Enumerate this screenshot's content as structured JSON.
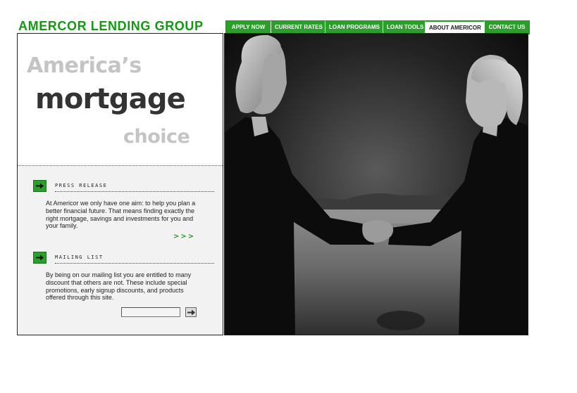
{
  "brand": {
    "name": "AMERCOR LENDING GROUP",
    "color": "#129a12"
  },
  "nav": {
    "items": [
      {
        "label": "APPLY NOW"
      },
      {
        "label": "CURRENT RATES"
      },
      {
        "label": "LOAN PROGRAMS"
      },
      {
        "label": "LOAN TOOLS"
      },
      {
        "label": "ABOUT AMERICOR",
        "active": true
      },
      {
        "label": "CONTACT US"
      }
    ],
    "accent": "#2aa02a"
  },
  "hero": {
    "line1": "America’s",
    "line2": "mortgage",
    "line3": "choice"
  },
  "press_release": {
    "title": "PRESS RELEASE",
    "icon": "arrow-right-icon",
    "body": "At Americor we only have one aim: to help you plan a better financial future. That means finding exactly the right mortgage, savings and investments for you and your family.",
    "more_label": ">>>"
  },
  "mailing_list": {
    "title": "MAILING LIST",
    "icon": "arrow-right-icon",
    "body": "By being on our mailing list you are entitled to many discount that others are not. These include special promotions, early signup discounts, and products offered through this site.",
    "input_value": "",
    "submit_icon": "arrow-right-icon"
  },
  "photo": {
    "subject": "two women shaking hands in black and white"
  }
}
